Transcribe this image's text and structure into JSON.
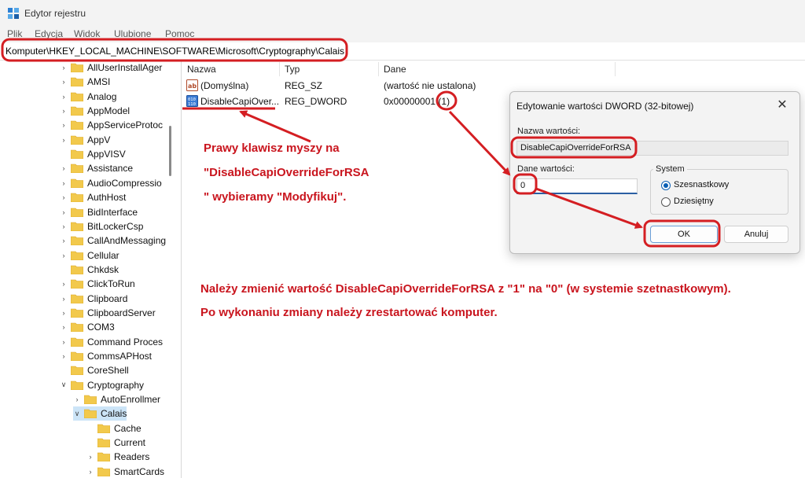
{
  "window": {
    "title": "Edytor rejestru"
  },
  "menu": [
    "Plik",
    "Edycja",
    "Widok",
    "Ulubione",
    "Pomoc"
  ],
  "address": "Komputer\\HKEY_LOCAL_MACHINE\\SOFTWARE\\Microsoft\\Cryptography\\Calais",
  "tree": {
    "items": [
      {
        "label": "AllUserInstallAger",
        "expanded": false
      },
      {
        "label": "AMSI",
        "expanded": false
      },
      {
        "label": "Analog",
        "expanded": false
      },
      {
        "label": "AppModel",
        "expanded": false
      },
      {
        "label": "AppServiceProtoc",
        "expanded": false
      },
      {
        "label": "AppV",
        "expanded": false
      },
      {
        "label": "AppVISV",
        "expanded": false
      },
      {
        "label": "Assistance",
        "expanded": false
      },
      {
        "label": "AudioCompressio",
        "expanded": false
      },
      {
        "label": "AuthHost",
        "expanded": false
      },
      {
        "label": "BidInterface",
        "expanded": false
      },
      {
        "label": "BitLockerCsp",
        "expanded": false
      },
      {
        "label": "CallAndMessaging",
        "expanded": false
      },
      {
        "label": "Cellular",
        "expanded": false
      },
      {
        "label": "Chkdsk",
        "expanded": false
      },
      {
        "label": "ClickToRun",
        "expanded": false
      },
      {
        "label": "Clipboard",
        "expanded": false
      },
      {
        "label": "ClipboardServer",
        "expanded": false
      },
      {
        "label": "COM3",
        "expanded": false
      },
      {
        "label": "Command Proces",
        "expanded": false
      },
      {
        "label": "CommsAPHost",
        "expanded": false
      },
      {
        "label": "CoreShell",
        "expanded": false
      },
      {
        "label": "Cryptography",
        "expanded": true
      },
      {
        "label": "AutoEnrollmer",
        "expanded": false
      },
      {
        "label": "Calais",
        "expanded": true,
        "selected": true
      },
      {
        "label": "Cache",
        "expanded": false
      },
      {
        "label": "Current",
        "expanded": false
      },
      {
        "label": "Readers",
        "expanded": false
      },
      {
        "label": "SmartCards",
        "expanded": false
      }
    ]
  },
  "list": {
    "columns": [
      "Nazwa",
      "Typ",
      "Dane"
    ],
    "rows": [
      {
        "name": "(Domyślna)",
        "type": "REG_SZ",
        "data": "(wartość nie ustalona)",
        "icon": "string-value-icon"
      },
      {
        "name": "DisableCapiOver...",
        "type": "REG_DWORD",
        "data": "0x00000001 (1)",
        "icon": "binary-value-icon"
      }
    ]
  },
  "dialog": {
    "title": "Edytowanie wartości DWORD (32-bitowej)",
    "close_glyph": "✕",
    "name_label": "Nazwa wartości:",
    "name_value": "DisableCapiOverrideForRSA",
    "data_label": "Dane wartości:",
    "data_value": "0",
    "base_group": "System",
    "base_hex": "Szesnastkowy",
    "base_dec": "Dziesiętny",
    "ok": "OK",
    "cancel": "Anuluj"
  },
  "annotations": {
    "note1_line1": "Prawy klawisz myszy na",
    "note1_line2": "\"DisableCapiOverrideForRSA",
    "note1_line3": "\" wybieramy \"Modyfikuj\".",
    "note2_line1": "Należy zmienić wartość DisableCapiOverrideForRSA z \"1\" na \"0\" (w systemie szetnastkowym).",
    "note2_line2": "Po wykonaniu zmiany należy zrestartować komputer."
  },
  "colors": {
    "annotation": "#c9151e",
    "folder": "#f2c94c",
    "selection": "#cce4f7"
  }
}
